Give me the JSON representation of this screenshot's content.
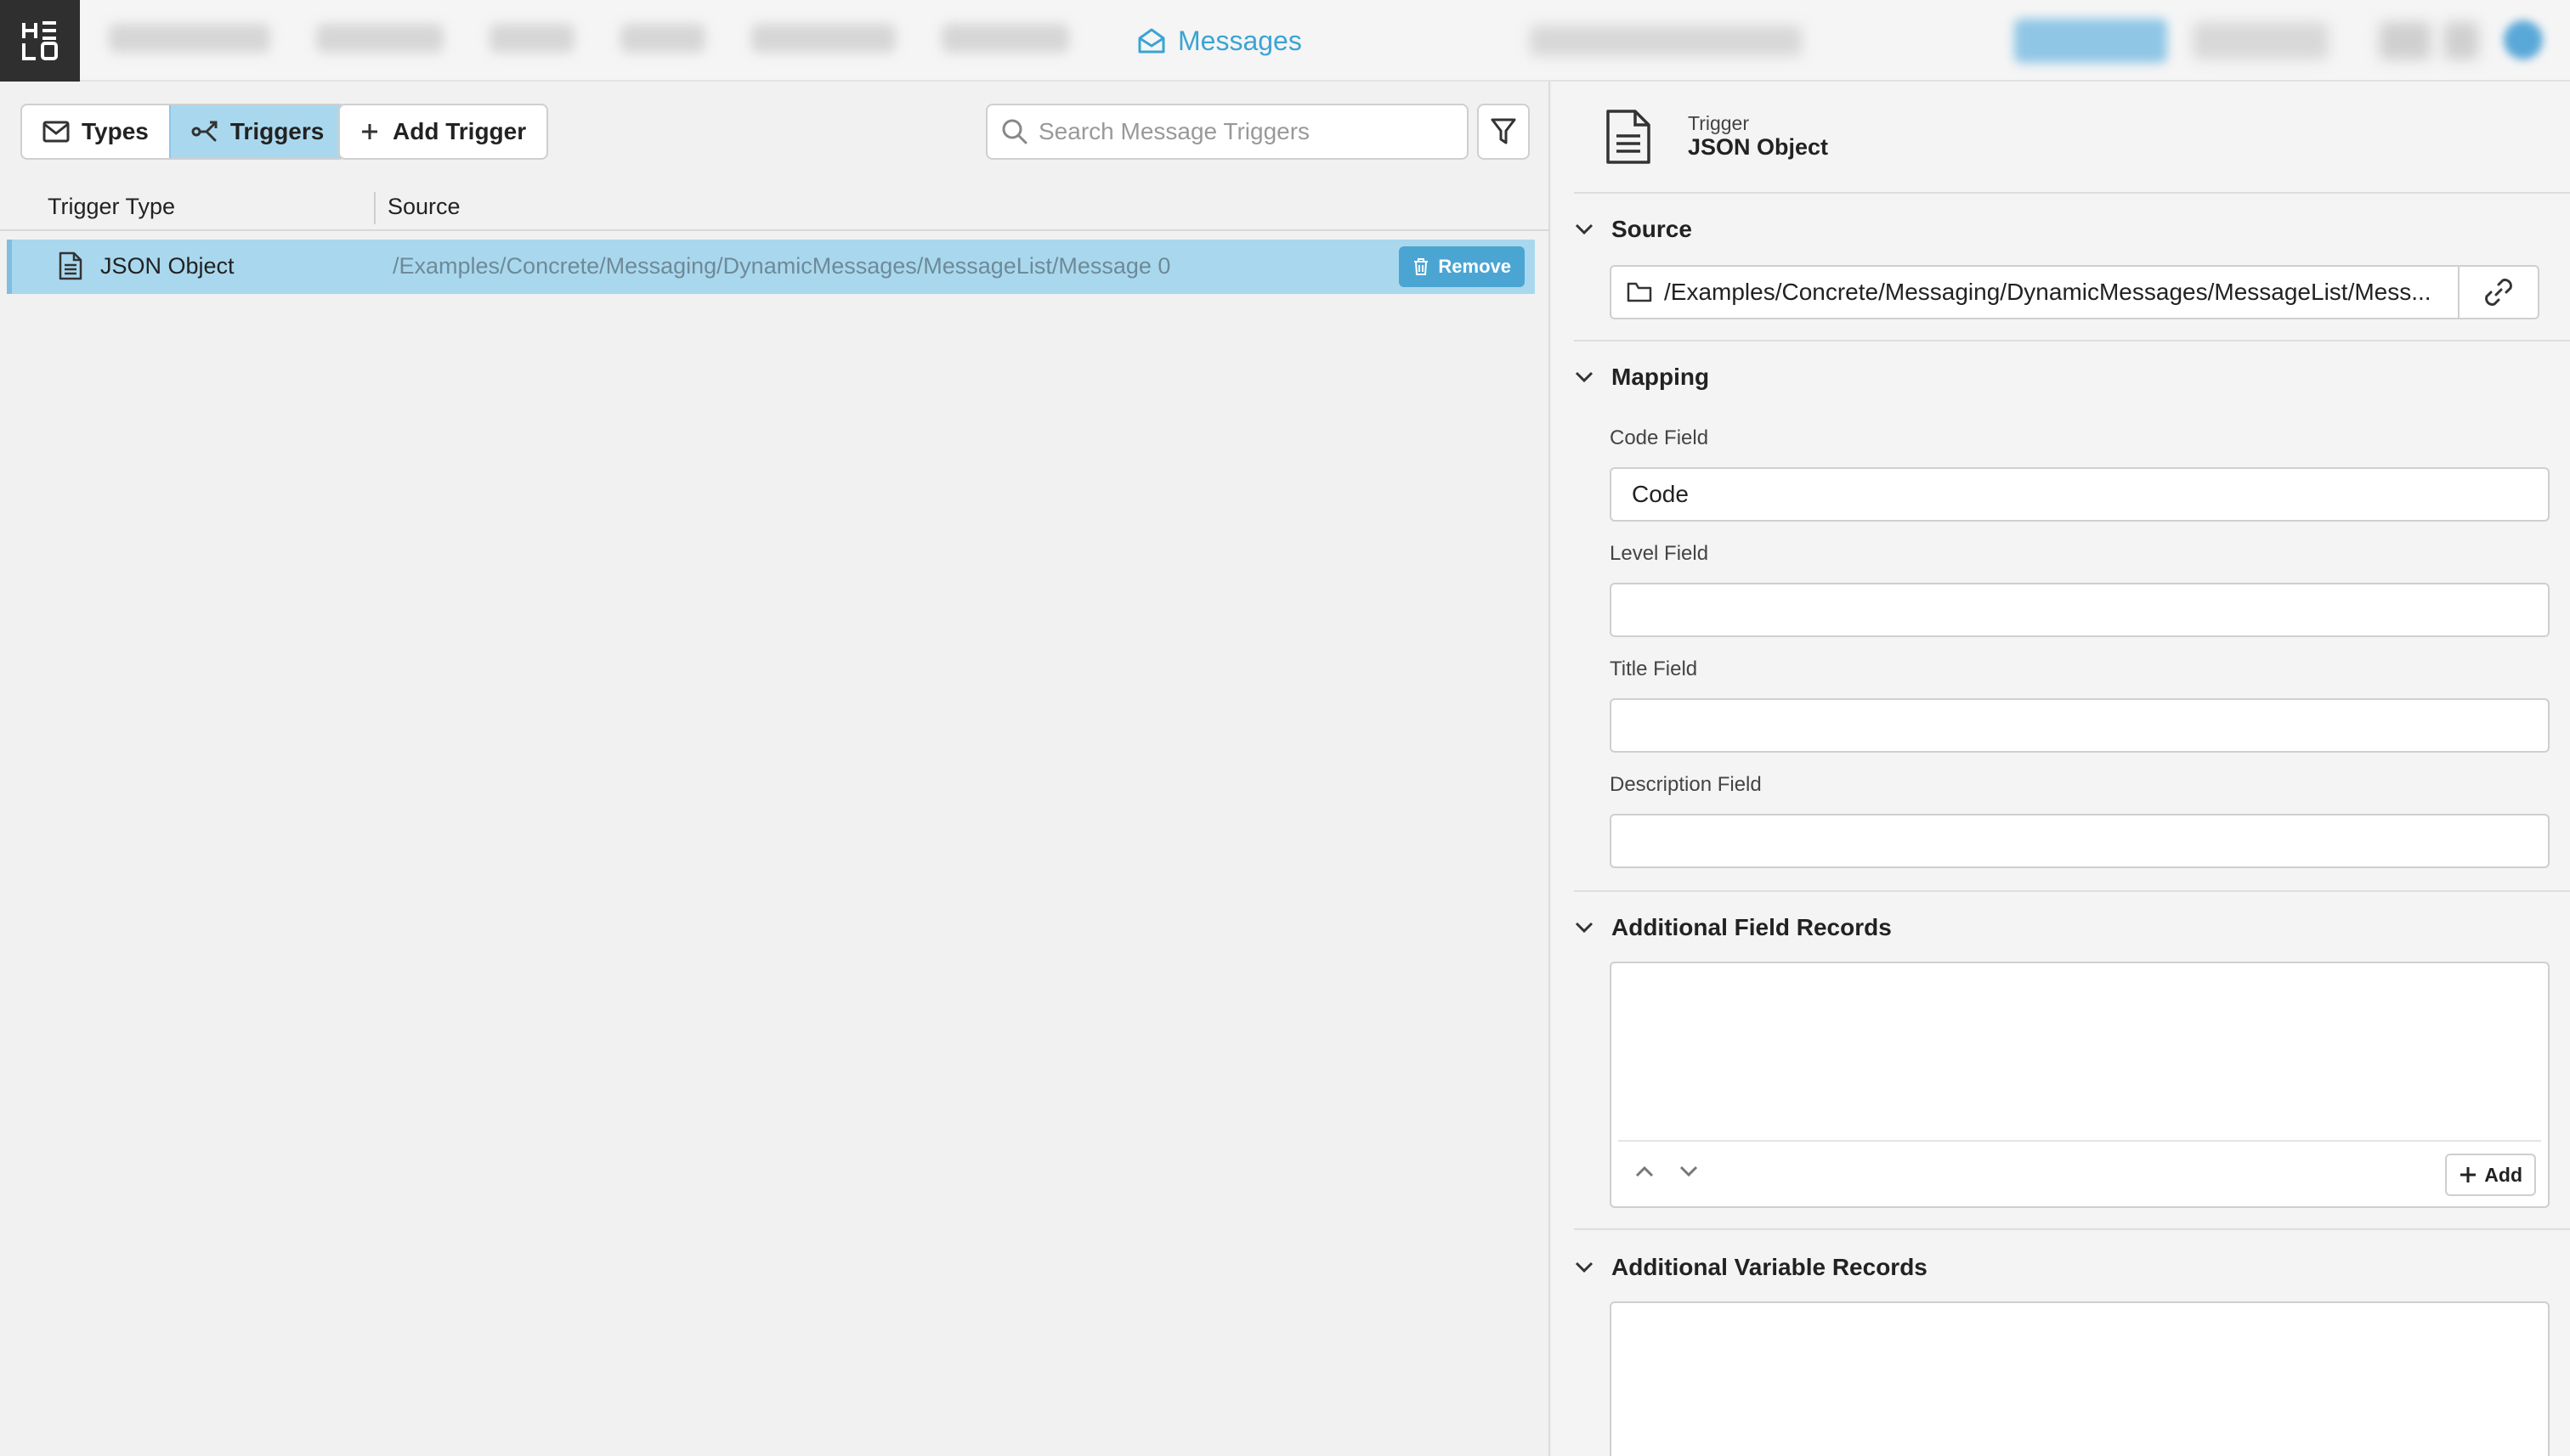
{
  "nav": {
    "active_label": "Messages"
  },
  "toolbar": {
    "types_label": "Types",
    "triggers_label": "Triggers",
    "add_trigger_label": "Add Trigger",
    "search_placeholder": "Search Message Triggers"
  },
  "table": {
    "columns": [
      "Trigger Type",
      "Source"
    ],
    "rows": [
      {
        "type": "JSON Object",
        "source": "/Examples/Concrete/Messaging/DynamicMessages/MessageList/Message 0",
        "action_label": "Remove"
      }
    ]
  },
  "detail": {
    "kind_label": "Trigger",
    "title": "JSON Object",
    "source_section": "Source",
    "source_path": "/Examples/Concrete/Messaging/DynamicMessages/MessageList/Mess...",
    "mapping_section": "Mapping",
    "fields": [
      {
        "label": "Code Field",
        "value": "Code"
      },
      {
        "label": "Level Field",
        "value": ""
      },
      {
        "label": "Title Field",
        "value": ""
      },
      {
        "label": "Description Field",
        "value": ""
      }
    ],
    "additional_field_section": "Additional Field Records",
    "add_label": "Add",
    "additional_variable_section": "Additional Variable Records"
  },
  "colors": {
    "accent": "#3ba4d4",
    "selection": "#a9d8ee",
    "remove_button": "#4ba5d2",
    "logo_bg": "#2f2f2f"
  }
}
